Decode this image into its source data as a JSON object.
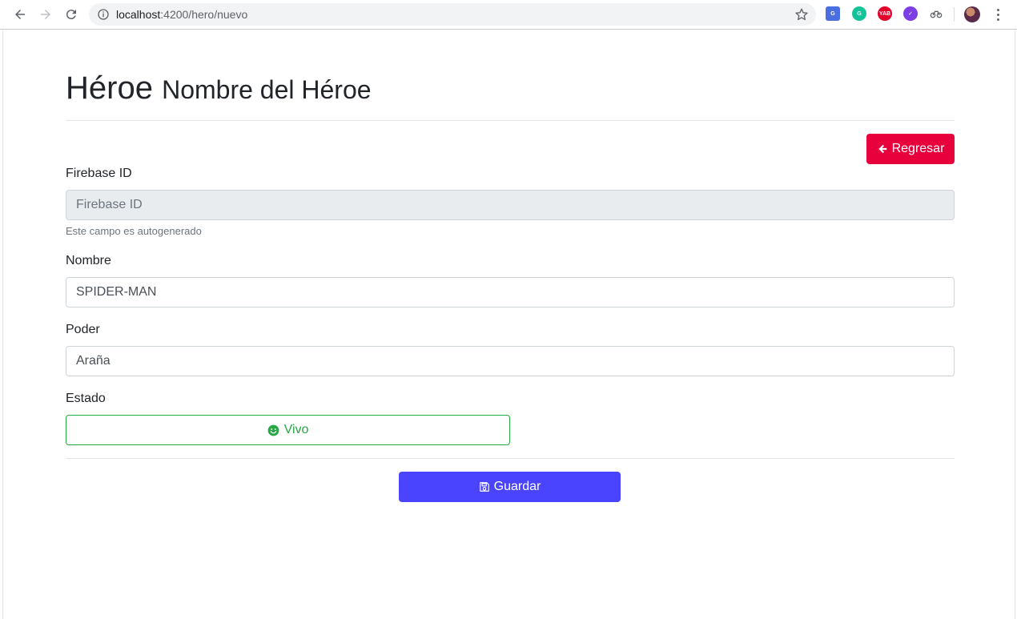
{
  "browser": {
    "url_host": "localhost",
    "url_rest": ":4200/hero/nuevo",
    "extensions": [
      "translate-icon",
      "grammarly-icon",
      "yab-icon",
      "check-icon",
      "bike-icon"
    ],
    "ext_yab_label": "YAB"
  },
  "page": {
    "title": "Héroe",
    "subtitle": "Nombre del Héroe",
    "back_button": "Regresar",
    "firebase_label": "Firebase ID",
    "firebase_placeholder": "Firebase ID",
    "firebase_help": "Este campo es autogenerado",
    "nombre_label": "Nombre",
    "nombre_value": "SPIDER-MAN",
    "poder_label": "Poder",
    "poder_value": "Araña",
    "estado_label": "Estado",
    "estado_button": "Vivo",
    "save_button": "Guardar"
  },
  "colors": {
    "danger": "#e8003d",
    "success": "#28a745",
    "primary": "#4a44ff"
  }
}
